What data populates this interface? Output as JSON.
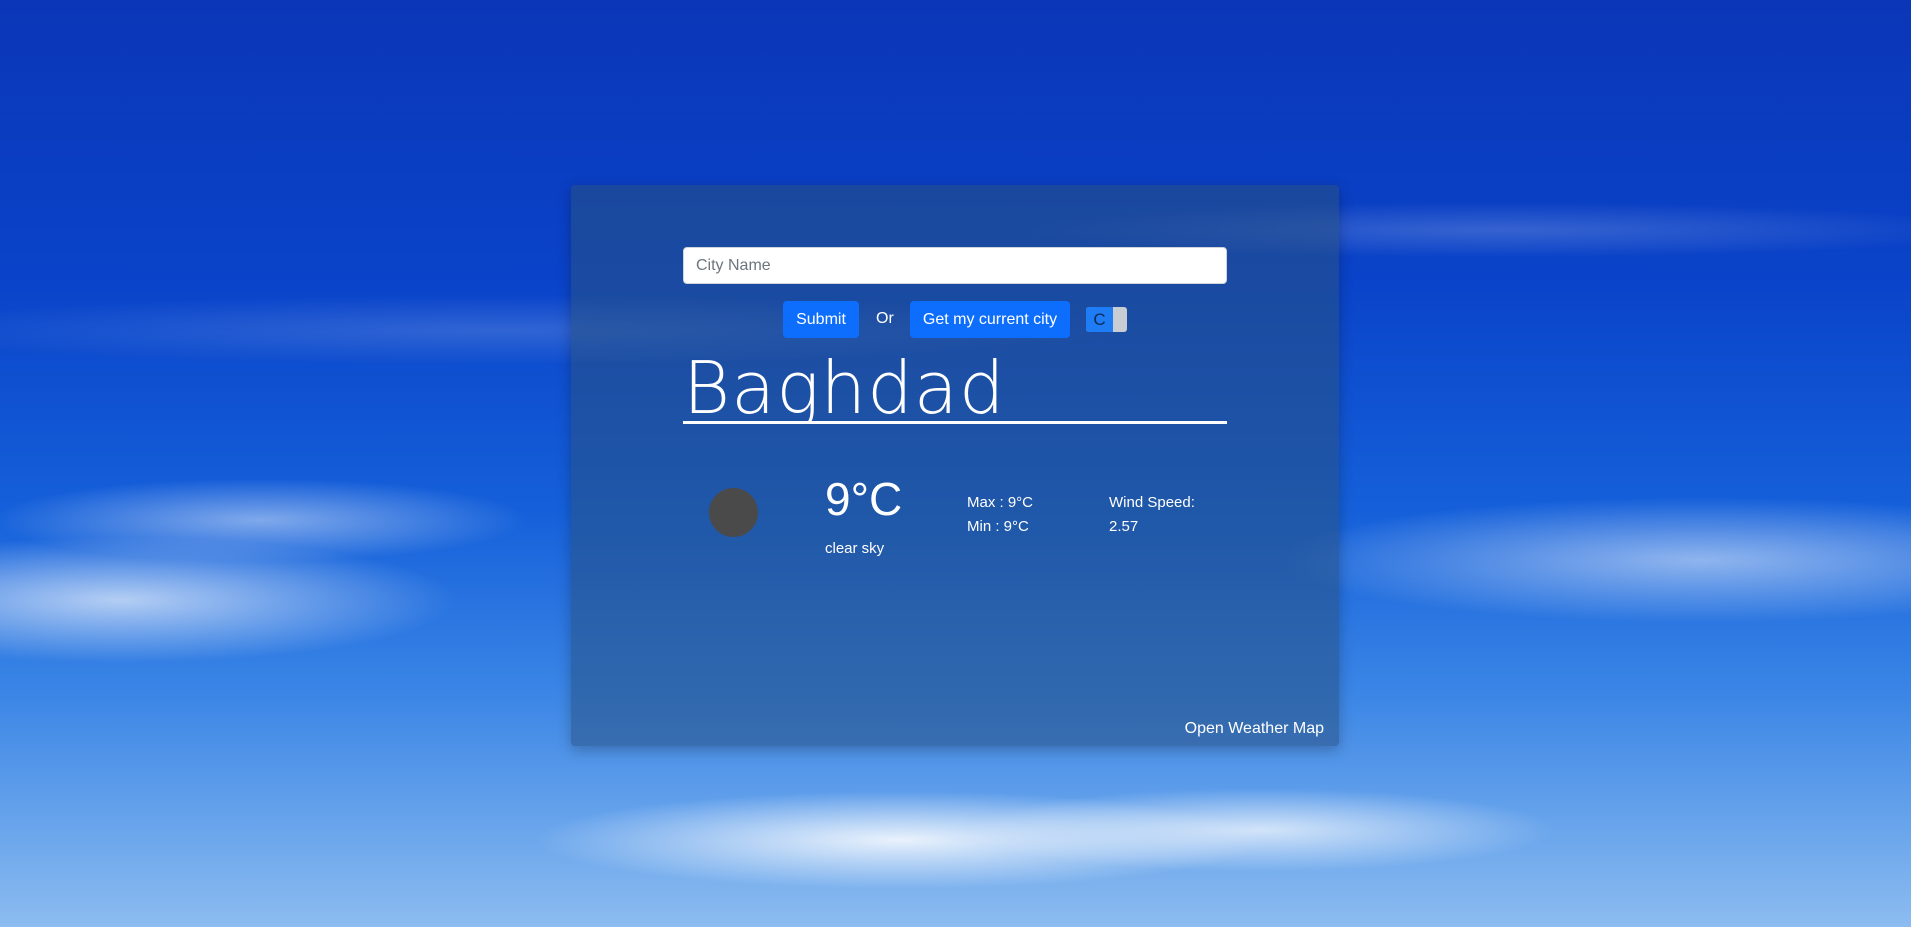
{
  "search": {
    "placeholder": "City Name",
    "value": ""
  },
  "actions": {
    "submit_label": "Submit",
    "or_label": "Or",
    "location_label": "Get my current city"
  },
  "unit_toggle": {
    "label": "C"
  },
  "weather": {
    "city": "Baghdad",
    "icon": "weather-icon",
    "temperature": "9°C",
    "description": "clear sky",
    "max": "Max : 9°C",
    "min": "Min : 9°C",
    "wind_label": "Wind Speed:",
    "wind_value": "2.57"
  },
  "footer": {
    "credit_label": "Open Weather Map"
  },
  "colors": {
    "primary_button": "#0d6efd",
    "card_overlay": "rgba(40, 80, 130, 0.55)",
    "icon_fill": "#4a4a4a"
  }
}
